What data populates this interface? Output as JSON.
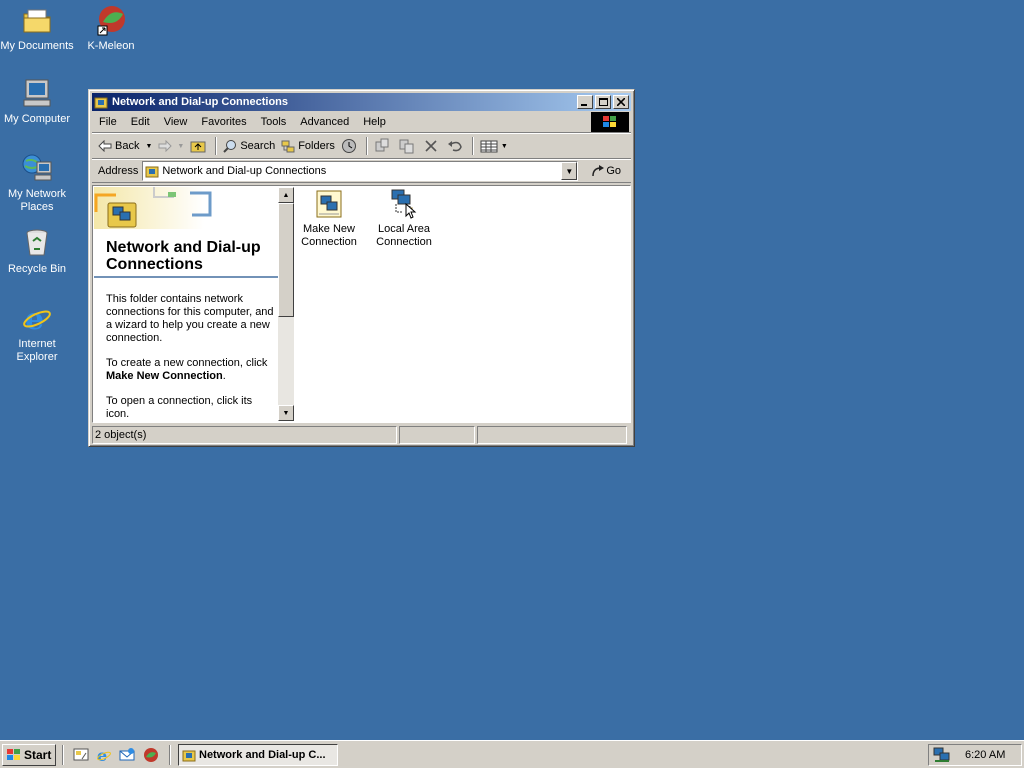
{
  "desktop": {
    "icons": [
      {
        "label": "My Documents"
      },
      {
        "label": "K-Meleon"
      },
      {
        "label": "My Computer"
      },
      {
        "label": "My Network Places"
      },
      {
        "label": "Recycle Bin"
      },
      {
        "label": "Internet Explorer"
      }
    ]
  },
  "window": {
    "title": "Network and Dial-up Connections",
    "menu": [
      "File",
      "Edit",
      "View",
      "Favorites",
      "Tools",
      "Advanced",
      "Help"
    ],
    "toolbar": {
      "back": "Back",
      "search": "Search",
      "folders": "Folders"
    },
    "address": {
      "label": "Address",
      "value": "Network and Dial-up Connections",
      "go": "Go"
    },
    "left_pane": {
      "title": "Network and Dial-up Connections",
      "para1": "This folder contains network connections for this computer, and a wizard to help you create a new connection.",
      "para2_prefix": "To create a new connection, click",
      "para2_bold": "Make New Connection",
      "para2_suffix": ".",
      "para3": "To open a connection, click its icon."
    },
    "items": [
      {
        "label": "Make New Connection",
        "icon": "make-new-connection-icon"
      },
      {
        "label": "Local Area Connection",
        "icon": "local-area-connection-icon"
      }
    ],
    "status": "2 object(s)"
  },
  "taskbar": {
    "start": "Start",
    "task": "Network and Dial-up C...",
    "clock": "6:20 AM"
  },
  "colors": {
    "desktop": "#3a6ea5",
    "title_start": "#0a246a",
    "title_end": "#a6caf0",
    "face": "#d4d0c8"
  }
}
